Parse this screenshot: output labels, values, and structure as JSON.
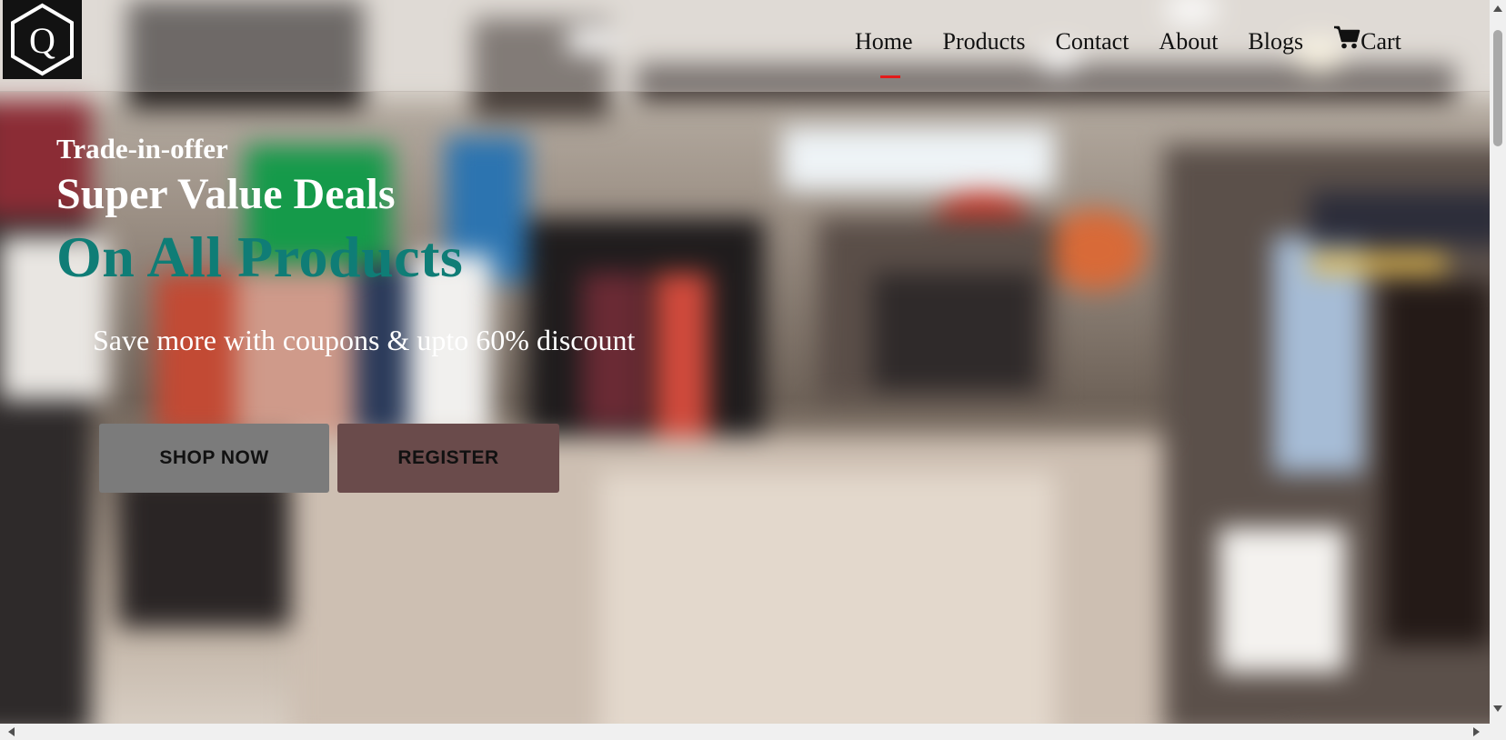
{
  "logo": {
    "letter": "Q",
    "icon": "hexagon-q-logo"
  },
  "nav": {
    "items": [
      {
        "label": "Home",
        "active": true
      },
      {
        "label": "Products",
        "active": false
      },
      {
        "label": "Contact",
        "active": false
      },
      {
        "label": "About",
        "active": false
      },
      {
        "label": "Blogs",
        "active": false
      }
    ],
    "cart": {
      "label": "Cart",
      "icon": "cart-icon"
    },
    "active_indicator_color": "#e31b1b"
  },
  "hero": {
    "eyebrow": "Trade-in-offer",
    "headline": "Super Value Deals",
    "headline_accent": "On All Products",
    "accent_color": "#0f7d76",
    "subtitle": "Save more with coupons & upto 60% discount",
    "buttons": {
      "shop": "SHOP NOW",
      "register": "REGISTER"
    }
  },
  "scrollbars": {
    "vertical": {
      "up_icon": "scroll-up-arrow-icon",
      "down_icon": "scroll-down-arrow-icon"
    },
    "horizontal": {
      "left_icon": "scroll-left-arrow-icon",
      "right_icon": "scroll-right-arrow-icon"
    }
  }
}
